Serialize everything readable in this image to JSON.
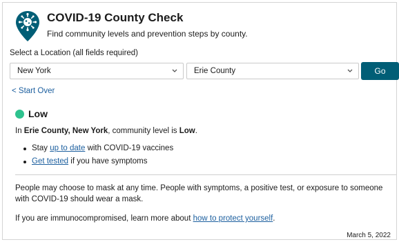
{
  "header": {
    "title": "COVID-19 County Check",
    "subtitle": "Find community levels and prevention steps by county."
  },
  "form": {
    "label": "Select a Location (all fields required)",
    "state_value": "New York",
    "county_value": "Erie County",
    "go_label": "Go"
  },
  "start_over_label": "< Start Over",
  "level": {
    "label": "Low",
    "color": "#2ec28e"
  },
  "summary": {
    "prefix": "In ",
    "location": "Erie County, New York",
    "middle": ", community level is ",
    "level": "Low",
    "suffix": "."
  },
  "bullets": [
    {
      "before": "Stay ",
      "link": "up to date",
      "after": " with COVID-19 vaccines"
    },
    {
      "before": "",
      "link": "Get tested",
      "after": " if you have symptoms"
    }
  ],
  "mask_text": "People may choose to mask at any time. People with symptoms, a positive test, or exposure to someone with COVID-19 should wear a mask.",
  "immuno": {
    "before": "If you are immunocompromised, learn more about ",
    "link": "how to protect yourself",
    "after": "."
  },
  "date": "March 5, 2022",
  "colors": {
    "accent": "#005e76",
    "link": "#1b5e9e"
  }
}
